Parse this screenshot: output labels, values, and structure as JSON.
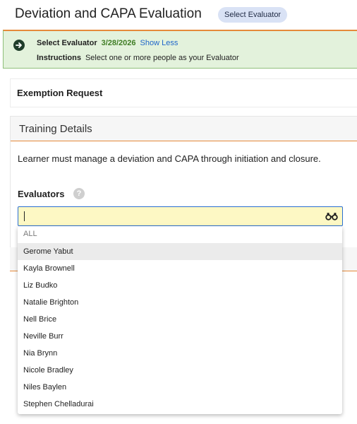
{
  "header": {
    "title": "Deviation and CAPA Evaluation",
    "status_badge": "Select Evaluator"
  },
  "banner": {
    "step": "Select Evaluator",
    "date": "3/28/2026",
    "toggle_link": "Show Less",
    "instructions_label": "Instructions",
    "instructions_text": "Select one or more people as your Evaluator",
    "accent_color": "#e58a3a",
    "bg_color": "#e3f2dc"
  },
  "exemption": {
    "title": "Exemption Request"
  },
  "training": {
    "title": "Training Details",
    "description": "Learner must manage a deviation and CAPA through initiation and closure.",
    "evaluators_label": "Evaluators",
    "help_icon": "?",
    "input_value": "",
    "search_icon": "binoculars-icon"
  },
  "dropdown": {
    "header": "ALL",
    "items": [
      "Gerome Yabut",
      "Kayla Brownell",
      "Liz Budko",
      "Natalie Brighton",
      "Nell Brice",
      "Neville Burr",
      "Nia Brynn",
      "Nicole Bradley",
      "Niles Baylen",
      "Stephen Chelladurai"
    ],
    "highlighted_index": 0
  }
}
